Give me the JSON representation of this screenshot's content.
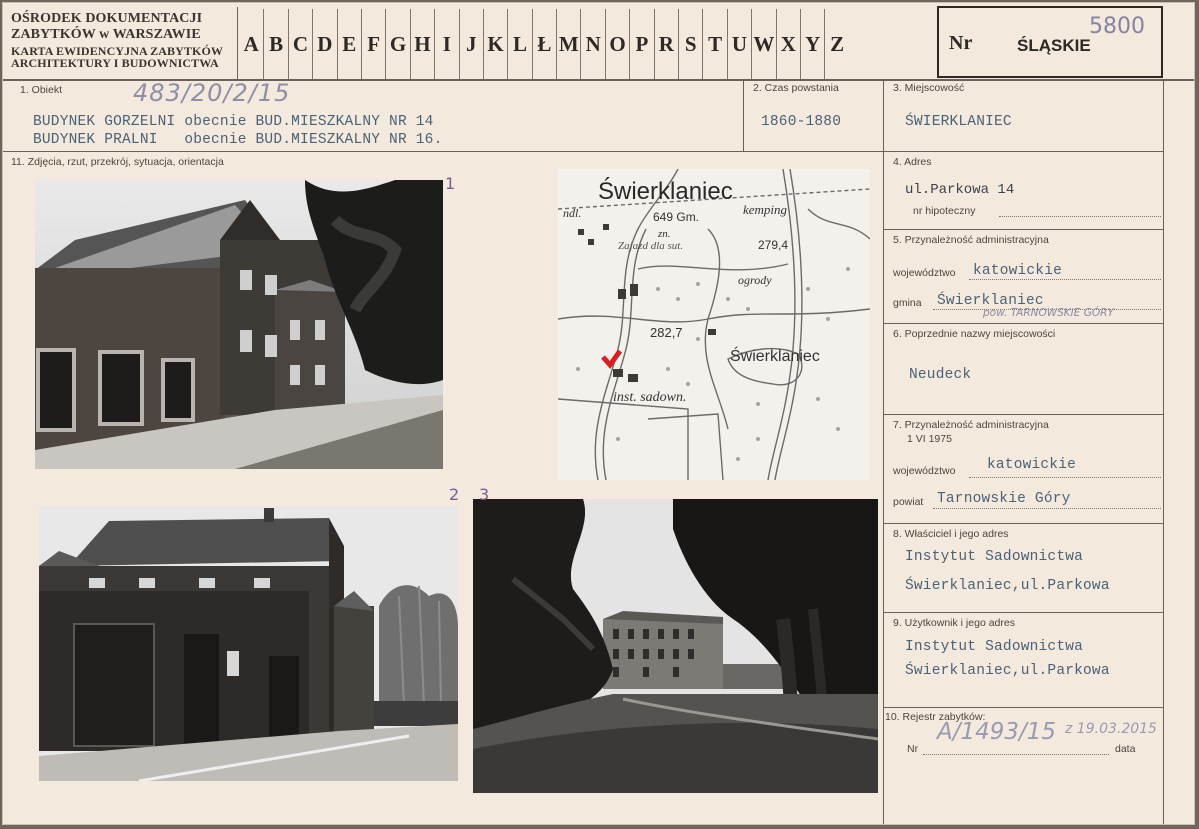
{
  "header": {
    "institution_line1": "OŚRODEK DOKUMENTACJI",
    "institution_line2": "ZABYTKÓW w WARSZAWIE",
    "card_line1": "KARTA EWIDENCYJNA ZABYTKÓW",
    "card_line2": "ARCHITEKTURY I BUDOWNICTWA",
    "letters": [
      "A",
      "B",
      "C",
      "D",
      "E",
      "F",
      "G",
      "H",
      "I",
      "J",
      "K",
      "L",
      "Ł",
      "M",
      "N",
      "O",
      "P",
      "R",
      "S",
      "T",
      "U",
      "W",
      "X",
      "Y",
      "Z"
    ],
    "nr_label": "Nr",
    "region": "ŚLĄSKIE",
    "handwritten_nr": "5800"
  },
  "section1": {
    "label": "1. Obiekt",
    "handwritten_ref": "483/20/2/15",
    "line1": "BUDYNEK GORZELNI obecnie BUD.MIESZKALNY NR 14",
    "line2": "BUDYNEK PRALNI   obecnie BUD.MIESZKALNY NR 16."
  },
  "section2": {
    "label": "2. Czas powstania",
    "value": "1860-1880"
  },
  "section3": {
    "label": "3. Miejscowość",
    "value": "ŚWIERKLANIEC"
  },
  "section11": {
    "label": "11. Zdjęcia, rzut, przekrój, sytuacja, orientacja"
  },
  "photos": {
    "p1_number": "1",
    "p2_number": "2",
    "p3_number": "3"
  },
  "map": {
    "town": "Świerklaniec",
    "labels": [
      "ndl.",
      "649 Gm.",
      "kemping",
      "zn.",
      "Zajazd dla sut.",
      "279,4",
      "ogrody",
      "282,7",
      "Świerklaniec",
      "inst. sadown."
    ]
  },
  "section4": {
    "label": "4. Adres",
    "value": "ul.Parkowa 14",
    "sub_label": "nr hipoteczny"
  },
  "section5": {
    "label": "5. Przynależność administracyjna",
    "woj_label": "województwo",
    "woj_value": "katowickie",
    "gmina_label": "gmina",
    "gmina_value": "Świerklaniec",
    "handwritten_pow": "pow. TARNOWSKIE GÓRY"
  },
  "section6": {
    "label": "6. Poprzednie nazwy miejscowości",
    "value": "Neudeck"
  },
  "section7": {
    "label1": "7. Przynależność administracyjna",
    "label2": "1 VI 1975",
    "woj_label": "województwo",
    "woj_value": "katowickie",
    "powiat_label": "powiat",
    "powiat_value": "Tarnowskie Góry"
  },
  "section8": {
    "label": "8. Właściciel i jego adres",
    "line1": "Instytut Sadownictwa",
    "line2": "Świerklaniec,ul.Parkowa"
  },
  "section9": {
    "label": "9. Użytkownik i jego adres",
    "line1": "Instytut Sadownictwa",
    "line2": "Świerklaniec,ul.Parkowa"
  },
  "section10": {
    "label": "10. Rejestr zabytków:",
    "nr_label": "Nr",
    "data_label": "data",
    "handwritten_nr": "A/1493/15",
    "handwritten_date": "z 19.03.2015"
  }
}
